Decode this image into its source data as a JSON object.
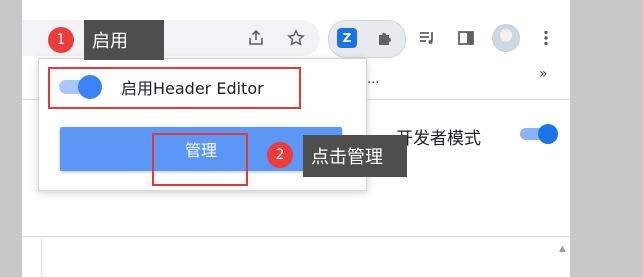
{
  "toolbar": {
    "icons": [
      "share-icon",
      "star-icon",
      "header-editor-icon",
      "puzzle-icon",
      "media-icon",
      "side-panel-icon",
      "avatar",
      "more-icon"
    ],
    "header_editor_glyph": "Z"
  },
  "bookmarks": {
    "partial_text": "有...",
    "more": "»"
  },
  "page": {
    "dev_mode_label": "开发者模式"
  },
  "popup": {
    "enable_label": "启用Header Editor",
    "manage_label": "管理"
  },
  "annotations": {
    "step1_number": "1",
    "step1_text": "启用",
    "step2_number": "2",
    "step2_text": "点击管理",
    "accent_color": "#e53935"
  }
}
